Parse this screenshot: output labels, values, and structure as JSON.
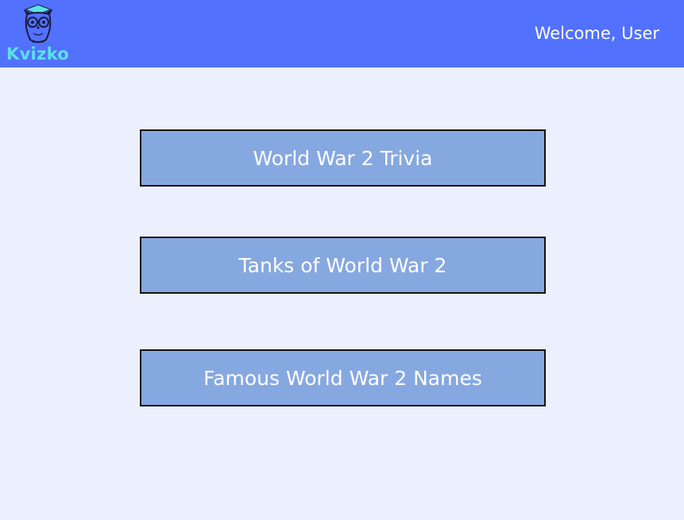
{
  "header": {
    "logo_text": "Kvizko",
    "logo_icon": "owl-graduate-icon",
    "welcome_text": "Welcome, User"
  },
  "quizzes": [
    {
      "label": "World War 2 Trivia"
    },
    {
      "label": "Tanks of World War 2"
    },
    {
      "label": "Famous World War 2 Names"
    }
  ],
  "colors": {
    "header_bg": "#5271ff",
    "page_bg": "#ecf0fe",
    "button_bg": "#86a8e0",
    "button_border": "#111111",
    "logo_text": "#5ce1e6",
    "text_light": "#ffffff"
  }
}
